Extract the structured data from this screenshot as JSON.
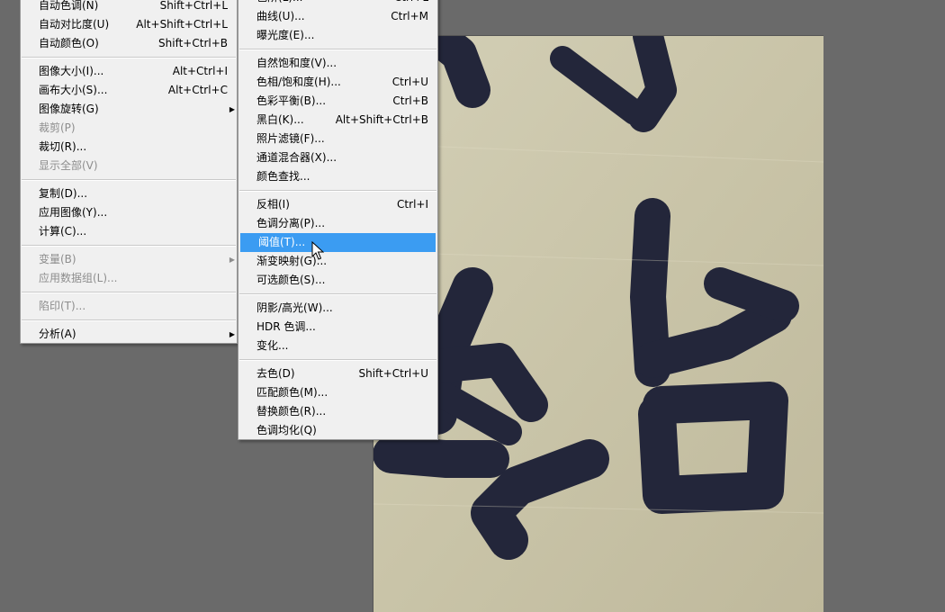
{
  "left_menu": {
    "groups": [
      [
        {
          "label": "自动色调(N)",
          "shortcut": "Shift+Ctrl+L",
          "enabled": true
        },
        {
          "label": "自动对比度(U)",
          "shortcut": "Alt+Shift+Ctrl+L",
          "enabled": true
        },
        {
          "label": "自动颜色(O)",
          "shortcut": "Shift+Ctrl+B",
          "enabled": true
        }
      ],
      [
        {
          "label": "图像大小(I)...",
          "shortcut": "Alt+Ctrl+I",
          "enabled": true
        },
        {
          "label": "画布大小(S)...",
          "shortcut": "Alt+Ctrl+C",
          "enabled": true
        },
        {
          "label": "图像旋转(G)",
          "shortcut": "",
          "enabled": true,
          "submenu": true
        },
        {
          "label": "裁剪(P)",
          "shortcut": "",
          "enabled": false
        },
        {
          "label": "裁切(R)...",
          "shortcut": "",
          "enabled": true
        },
        {
          "label": "显示全部(V)",
          "shortcut": "",
          "enabled": false
        }
      ],
      [
        {
          "label": "复制(D)...",
          "shortcut": "",
          "enabled": true
        },
        {
          "label": "应用图像(Y)...",
          "shortcut": "",
          "enabled": true
        },
        {
          "label": "计算(C)...",
          "shortcut": "",
          "enabled": true
        }
      ],
      [
        {
          "label": "变量(B)",
          "shortcut": "",
          "enabled": false,
          "submenu": true
        },
        {
          "label": "应用数据组(L)...",
          "shortcut": "",
          "enabled": false
        }
      ],
      [
        {
          "label": "陷印(T)...",
          "shortcut": "",
          "enabled": false
        }
      ],
      [
        {
          "label": "分析(A)",
          "shortcut": "",
          "enabled": true,
          "submenu": true
        }
      ]
    ]
  },
  "right_menu": {
    "groups": [
      [
        {
          "label": "色阶(L)...",
          "shortcut": "Ctrl+L",
          "enabled": true
        },
        {
          "label": "曲线(U)...",
          "shortcut": "Ctrl+M",
          "enabled": true
        },
        {
          "label": "曝光度(E)...",
          "shortcut": "",
          "enabled": true
        }
      ],
      [
        {
          "label": "自然饱和度(V)...",
          "shortcut": "",
          "enabled": true
        },
        {
          "label": "色相/饱和度(H)...",
          "shortcut": "Ctrl+U",
          "enabled": true
        },
        {
          "label": "色彩平衡(B)...",
          "shortcut": "Ctrl+B",
          "enabled": true
        },
        {
          "label": "黑白(K)...",
          "shortcut": "Alt+Shift+Ctrl+B",
          "enabled": true
        },
        {
          "label": "照片滤镜(F)...",
          "shortcut": "",
          "enabled": true
        },
        {
          "label": "通道混合器(X)...",
          "shortcut": "",
          "enabled": true
        },
        {
          "label": "颜色查找...",
          "shortcut": "",
          "enabled": true
        }
      ],
      [
        {
          "label": "反相(I)",
          "shortcut": "Ctrl+I",
          "enabled": true
        },
        {
          "label": "色调分离(P)...",
          "shortcut": "",
          "enabled": true
        },
        {
          "label": "阈值(T)...",
          "shortcut": "",
          "enabled": true,
          "selected": true
        },
        {
          "label": "渐变映射(G)...",
          "shortcut": "",
          "enabled": true
        },
        {
          "label": "可选颜色(S)...",
          "shortcut": "",
          "enabled": true
        }
      ],
      [
        {
          "label": "阴影/高光(W)...",
          "shortcut": "",
          "enabled": true
        },
        {
          "label": "HDR 色调...",
          "shortcut": "",
          "enabled": true
        },
        {
          "label": "变化...",
          "shortcut": "",
          "enabled": true
        }
      ],
      [
        {
          "label": "去色(D)",
          "shortcut": "Shift+Ctrl+U",
          "enabled": true
        },
        {
          "label": "匹配颜色(M)...",
          "shortcut": "",
          "enabled": true
        },
        {
          "label": "替换颜色(R)...",
          "shortcut": "",
          "enabled": true
        },
        {
          "label": "色调均化(Q)",
          "shortcut": "",
          "enabled": true
        }
      ]
    ]
  },
  "colors": {
    "workspace_bg": "#6a6a6a",
    "menu_bg": "#f0f0f0",
    "highlight": "#3b9cf2",
    "disabled_text": "#8d8d8d",
    "paper": "#cdc8ae",
    "ink": "#23263a"
  },
  "icons": {
    "submenu_arrow": "triangle-right-icon",
    "cursor": "mouse-pointer-icon"
  }
}
